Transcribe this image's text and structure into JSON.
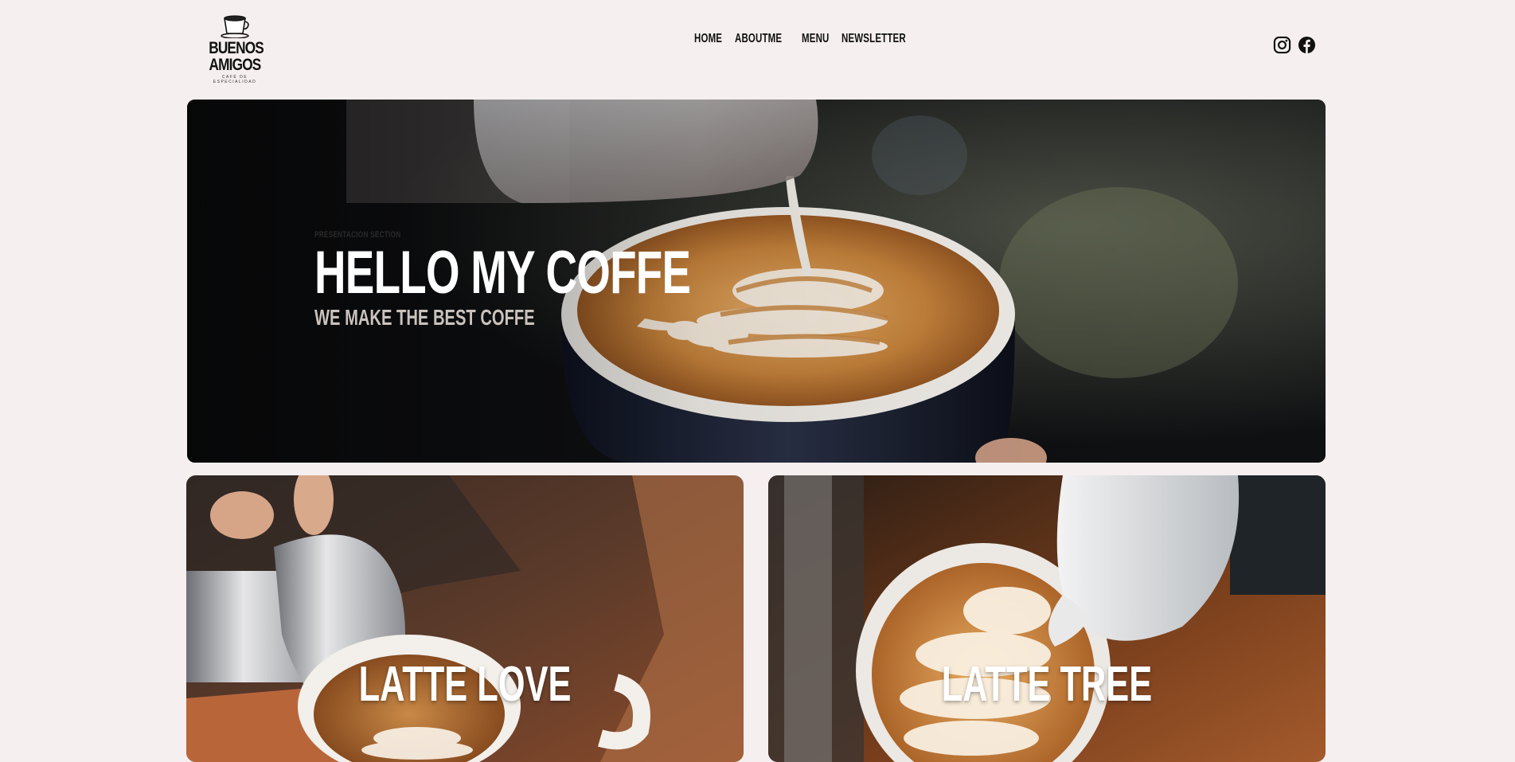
{
  "brand": {
    "name_line1": "BUENOS",
    "name_line2": "AMIGOS",
    "tagline": "CAFÉ DE ESPECIALIDAD",
    "logo_icon": "coffee-cup-icon"
  },
  "nav": {
    "items": [
      "HOME",
      "ABOUTME",
      "MENU",
      "NEWSLETTER"
    ]
  },
  "social": {
    "icons": [
      "instagram-icon",
      "facebook-icon"
    ]
  },
  "hero": {
    "kicker": "PRESENTACION SECTION",
    "title": "HELLO MY COFFE",
    "subtitle": "WE MAKE THE BEST COFFE"
  },
  "cards": [
    {
      "title": "LATTE LOVE"
    },
    {
      "title": "LATTE TREE"
    }
  ],
  "colors": {
    "background": "#f5efef",
    "text_dark": "#111111",
    "text_light": "#ffffff",
    "coffee": "#c4843e"
  }
}
